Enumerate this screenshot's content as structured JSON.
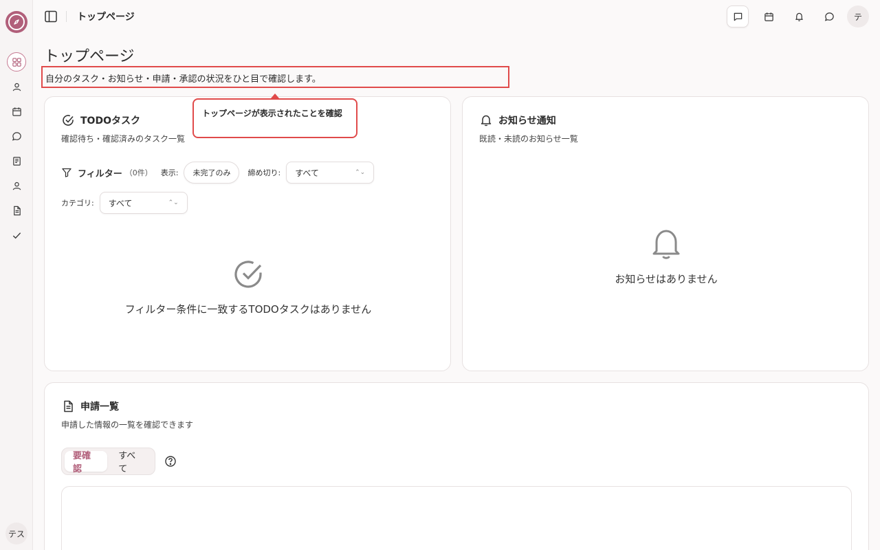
{
  "header": {
    "breadcrumb": "トップページ",
    "avatar": "テ"
  },
  "sidebar": {
    "user": "テス",
    "icons": [
      "dashboard-icon",
      "user-icon",
      "calendar-icon",
      "chat-icon",
      "book-icon",
      "profile-icon",
      "file-icon",
      "check-icon"
    ]
  },
  "page": {
    "title": "トップページ",
    "description": "自分のタスク・お知らせ・申請・承認の状況をひと目で確認します。"
  },
  "tooltip": {
    "text": "トップページが表示されたことを確認"
  },
  "todo": {
    "title": "TODOタスク",
    "subtitle": "確認待ち・確認済みのタスク一覧",
    "filter_label": "フィルター",
    "filter_count": "（0件）",
    "display_label": "表示:",
    "display_value": "未完了のみ",
    "deadline_label": "締め切り:",
    "deadline_value": "すべて",
    "category_label": "カテゴリ:",
    "category_value": "すべて",
    "empty": "フィルター条件に一致するTODOタスクはありません"
  },
  "notices": {
    "title": "お知らせ通知",
    "subtitle": "既読・未読のお知らせ一覧",
    "empty": "お知らせはありません"
  },
  "requests": {
    "title": "申請一覧",
    "subtitle": "申請した情報の一覧を確認できます",
    "tab_required": "要確認",
    "tab_all": "すべて"
  },
  "colors": {
    "accent": "#b15f7a",
    "highlight": "#e04a4a"
  }
}
